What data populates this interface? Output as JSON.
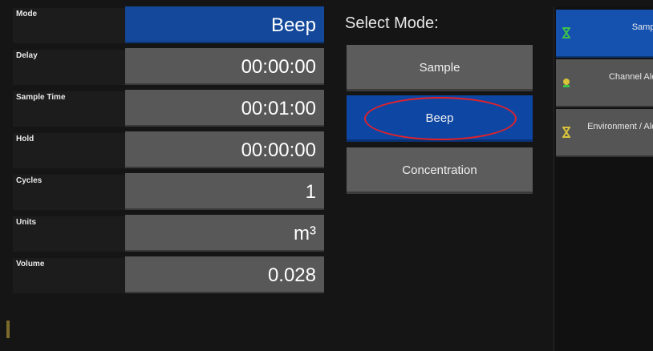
{
  "settings": {
    "rows": [
      {
        "label": "Mode",
        "value": "Beep"
      },
      {
        "label": "Delay",
        "value": "00:00:00"
      },
      {
        "label": "Sample Time",
        "value": "00:01:00"
      },
      {
        "label": "Hold",
        "value": "00:00:00"
      },
      {
        "label": "Cycles",
        "value": "1"
      },
      {
        "label": "Units",
        "value": "m³"
      },
      {
        "label": "Volume",
        "value": "0.028"
      }
    ]
  },
  "mode_select": {
    "title": "Select Mode:",
    "options": [
      {
        "label": "Sample",
        "active": false
      },
      {
        "label": "Beep",
        "active": true
      },
      {
        "label": "Concentration",
        "active": false
      }
    ]
  },
  "sidebar": {
    "items": [
      {
        "label": "Sample",
        "icon": "hourglass-icon",
        "active": true
      },
      {
        "label": "Channel Alert",
        "icon": "channel-icon",
        "active": false
      },
      {
        "label": "Environment / Alert",
        "icon": "hourglass-icon",
        "active": false
      }
    ]
  },
  "colors": {
    "accent_blue": "#13489a",
    "button_gray": "#5c5c5c",
    "annotation_red": "#e3212a",
    "icon_green": "#3cc24a",
    "icon_yellow": "#d8c33a"
  }
}
